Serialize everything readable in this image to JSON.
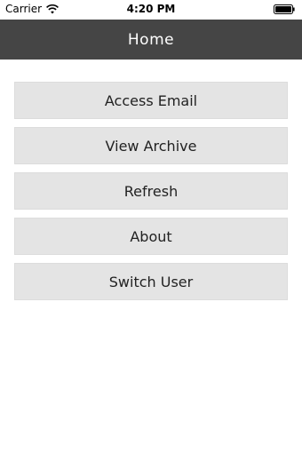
{
  "status_bar": {
    "carrier": "Carrier",
    "time": "4:20 PM",
    "wifi_icon": "wifi-icon",
    "battery_icon": "battery-icon"
  },
  "nav_bar": {
    "title": "Home",
    "background": "#454545"
  },
  "menu": {
    "items": [
      {
        "label": "Access Email"
      },
      {
        "label": "View Archive"
      },
      {
        "label": "Refresh"
      },
      {
        "label": "About"
      },
      {
        "label": "Switch User"
      }
    ]
  }
}
